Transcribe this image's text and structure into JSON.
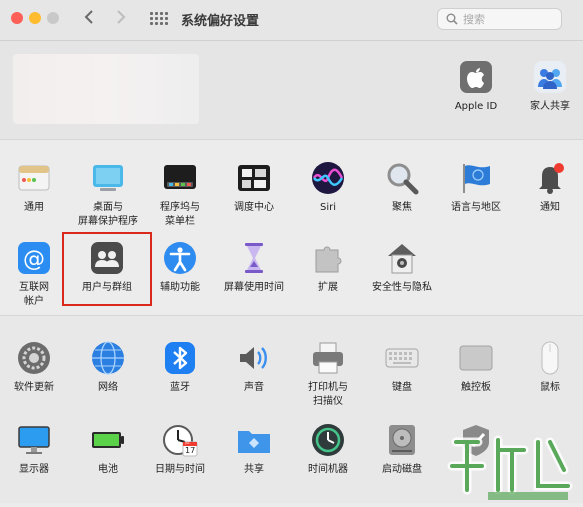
{
  "window": {
    "title": "系统偏好设置",
    "search_placeholder": "搜索"
  },
  "colors": {
    "close": "#fe5f57",
    "minimize": "#febc2e",
    "zoom": "#c9c9c9",
    "highlight_box": "#d9281c",
    "accent": "#1a84f0"
  },
  "account": {
    "apple_id": "Apple ID",
    "family": "家人共享"
  },
  "row1": [
    "通用",
    "桌面与\n屏幕保护程序",
    "程序坞与\n菜单栏",
    "调度中心",
    "Siri",
    "聚焦",
    "语言与地区",
    "通知"
  ],
  "row2": [
    "互联网\n帐户",
    "用户与群组",
    "辅助功能",
    "屏幕使用时间",
    "扩展",
    "安全性与隐私"
  ],
  "row3": [
    "软件更新",
    "网络",
    "蓝牙",
    "声音",
    "打印机与\n扫描仪",
    "键盘",
    "触控板",
    "鼠标"
  ],
  "row4": [
    "显示器",
    "电池",
    "日期与时间",
    "共享",
    "时间机器",
    "启动磁盘",
    ""
  ],
  "calendar": {
    "month": "JUL",
    "day": "17"
  },
  "icons": {
    "row1": [
      "general-icon",
      "desktop-screensaver-icon",
      "dock-icon",
      "mission-control-icon",
      "siri-icon",
      "spotlight-icon",
      "language-region-icon",
      "notifications-icon"
    ],
    "row2": [
      "internet-accounts-icon",
      "users-groups-icon",
      "accessibility-icon",
      "screen-time-icon",
      "extensions-icon",
      "security-privacy-icon"
    ],
    "row3": [
      "software-update-icon",
      "network-icon",
      "bluetooth-icon",
      "sound-icon",
      "printer-icon",
      "keyboard-icon",
      "trackpad-icon",
      "mouse-icon"
    ],
    "row4": [
      "display-icon",
      "battery-icon",
      "date-time-icon",
      "sharing-icon",
      "time-machine-icon",
      "startup-disk-icon",
      "profiles-icon"
    ]
  }
}
